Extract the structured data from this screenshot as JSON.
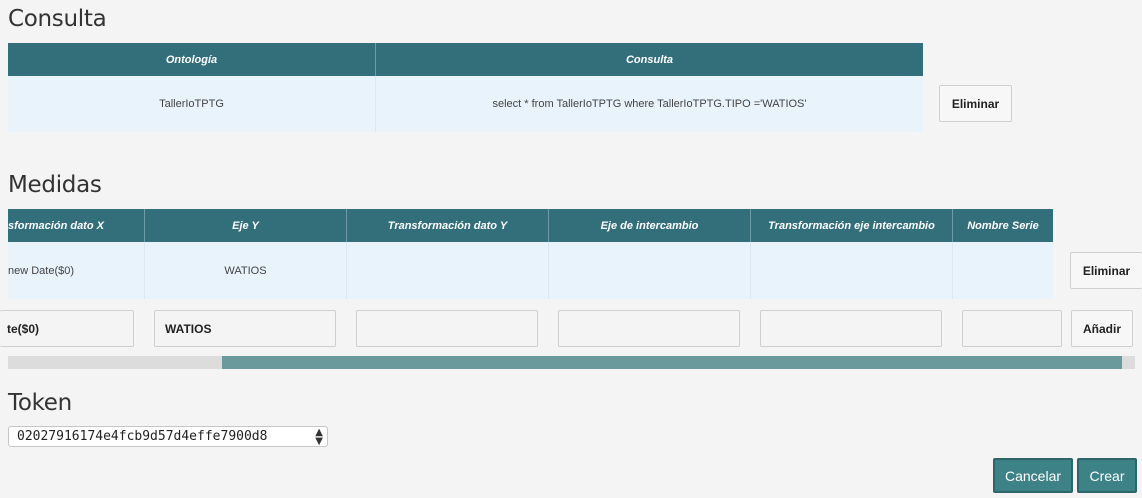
{
  "consulta": {
    "title": "Consulta",
    "headers": [
      "Ontología",
      "Consulta"
    ],
    "row": [
      "TallerIoTPTG",
      "select * from TallerIoTPTG where TallerIoTPTG.TIPO ='WATIOS'"
    ],
    "delete_label": "Eliminar"
  },
  "medidas": {
    "title": "Medidas",
    "headers": [
      "sformación dato X",
      "Eje Y",
      "Transformación dato Y",
      "Eje de intercambio",
      "Transformación eje intercambio",
      "Nombre Serie"
    ],
    "row": [
      "new Date($0)",
      "WATIOS",
      "",
      "",
      "",
      ""
    ],
    "delete_label": "Eliminar",
    "inputs": [
      "te($0)",
      "WATIOS",
      "",
      "",
      "",
      ""
    ],
    "add_label": "Añadir",
    "scroll": {
      "thumb_start_fraction": 0.19,
      "thumb_size_fraction": 0.8
    }
  },
  "token": {
    "title": "Token",
    "selected": "02027916174e4fcb9d57d4effe7900d8",
    "arrows": "▲▼"
  },
  "footer": {
    "cancel_label": "Cancelar",
    "create_label": "Crear"
  },
  "colors": {
    "header_bg": "#336e7b",
    "row_bg": "#e8f3fc",
    "button_teal": "#3d8287",
    "scroll_thumb": "#6a9a9c"
  },
  "icons": {
    "select_arrow": "chevron-updown-icon"
  }
}
